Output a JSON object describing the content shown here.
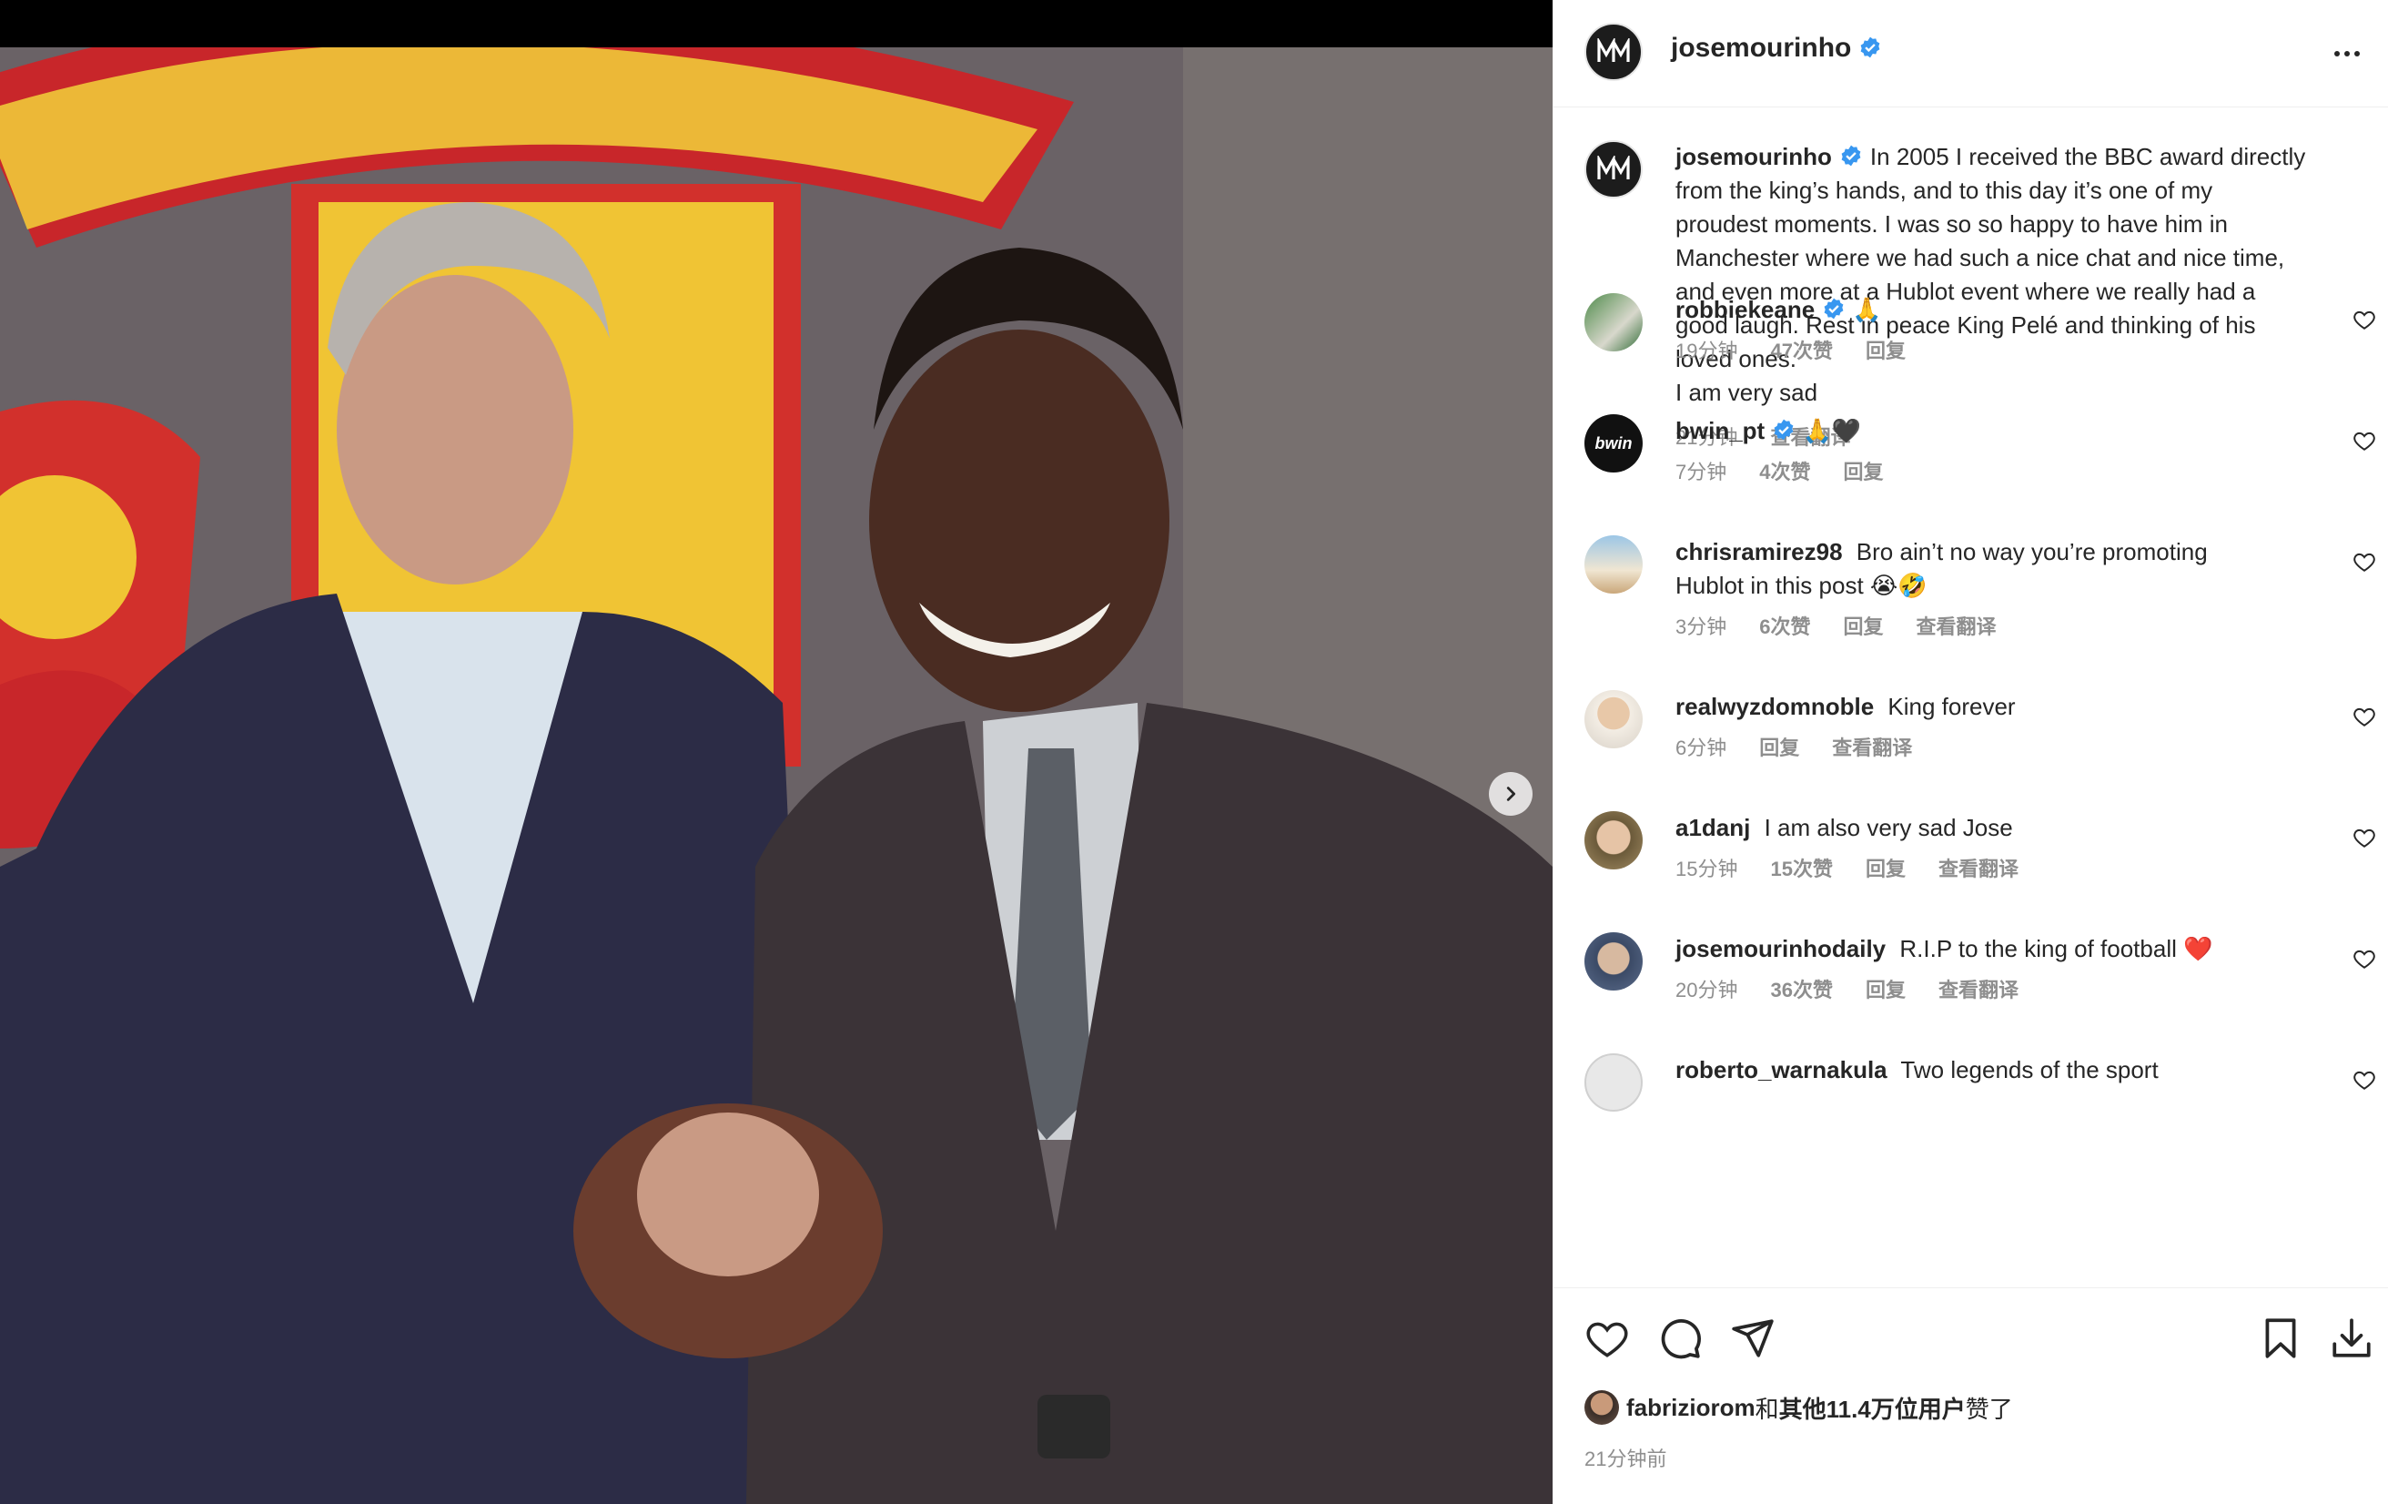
{
  "post": {
    "username": "josemourinho",
    "caption_lines": [
      "In 2005 I received the BBC award directly",
      "from the king’s hands, and to this day it’s one of my",
      "proudest moments. I was so so happy to have him in",
      "Manchester where we had such a nice chat and nice time,",
      "and even more at a Hublot event where we really had a",
      "good laugh. Rest in peace King Pelé and thinking of his",
      "loved ones.",
      "I am very sad"
    ],
    "caption_time": "21分钟",
    "caption_translate": "查看翻译"
  },
  "comments": [
    {
      "username": "robbiekeane",
      "verified": true,
      "text": "🙏",
      "time": "19分钟",
      "likes": "47次赞",
      "reply": "回复",
      "translate": ""
    },
    {
      "username": "bwin_pt",
      "verified": true,
      "text": "🙏🖤",
      "time": "7分钟",
      "likes": "4次赞",
      "reply": "回复",
      "translate": ""
    },
    {
      "username": "chrisramirez98",
      "verified": false,
      "text": "Bro ain’t no way you’re promoting",
      "text2": "Hublot in this post 😭🤣",
      "time": "3分钟",
      "likes": "6次赞",
      "reply": "回复",
      "translate": "查看翻译"
    },
    {
      "username": "realwyzdomnoble",
      "verified": false,
      "text": "King forever",
      "time": "6分钟",
      "likes": "",
      "reply": "回复",
      "translate": "查看翻译"
    },
    {
      "username": "a1danj",
      "verified": false,
      "text": "I am also very sad Jose",
      "time": "15分钟",
      "likes": "15次赞",
      "reply": "回复",
      "translate": "查看翻译"
    },
    {
      "username": "josemourinhodaily",
      "verified": false,
      "text": "R.I.P to the king of football ❤️",
      "time": "20分钟",
      "likes": "36次赞",
      "reply": "回复",
      "translate": "查看翻译"
    },
    {
      "username": "roberto_warnakula",
      "verified": false,
      "text": "Two legends of the sport",
      "time": "",
      "likes": "",
      "reply": "",
      "translate": ""
    }
  ],
  "likes_summary": {
    "liker": "fabriziorom",
    "connector": "和",
    "others": "其他11.4万位用户",
    "suffix": "赞了"
  },
  "posted_time": "21分钟前",
  "icons": [
    "verified-badge-icon",
    "more-options-icon",
    "heart-icon",
    "comment-icon",
    "share-icon",
    "bookmark-icon",
    "download-icon",
    "chevron-right-icon"
  ],
  "colors": {
    "verified": "#3897f0",
    "text": "#262626",
    "muted": "#8e8e8e",
    "heart_red": "#ed4956"
  }
}
